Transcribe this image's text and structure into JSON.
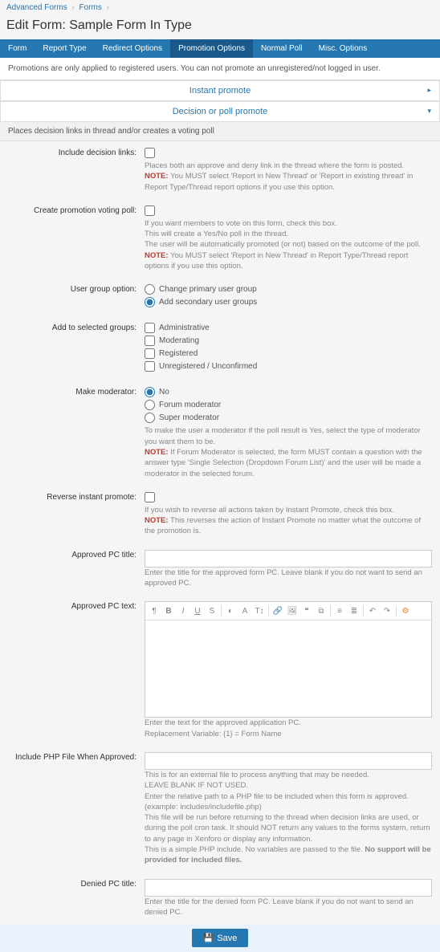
{
  "breadcrumb": {
    "a": "Advanced Forms",
    "b": "Forms"
  },
  "page_title": "Edit Form: Sample Form In Type",
  "tabs": [
    "Form",
    "Report Type",
    "Redirect Options",
    "Promotion Options",
    "Normal Poll",
    "Misc. Options"
  ],
  "info_bar": "Promotions are only applied to registered users. You can not promote an unregistered/not logged in user.",
  "acc1": "Instant promote",
  "acc2": "Decision or poll promote",
  "section": "Places decision links in thread and/or creates a voting poll",
  "f_decision": {
    "label": "Include decision links:",
    "help1": "Places both an approve and deny link in the thread where the form is posted.",
    "note": "NOTE:",
    "help2": " You MUST select 'Report in New Thread' or 'Report in existing thread' in Report Type/Thread report options if you use this option."
  },
  "f_poll": {
    "label": "Create promotion voting poll:",
    "help1": "If you want members to vote on this form, check this box.",
    "help2": "This will create a Yes/No poll in the thread.",
    "help3": "The user will be automatically promoted (or not) based on the outcome of the poll.",
    "note": "NOTE:",
    "help4": " You MUST select 'Report in New Thread' in Report Type/Thread report options if you use this option."
  },
  "f_group": {
    "label": "User group option:",
    "opt1": "Change primary user group",
    "opt2": "Add secondary user groups"
  },
  "f_add": {
    "label": "Add to selected groups:",
    "opts": [
      "Administrative",
      "Moderating",
      "Registered",
      "Unregistered / Unconfirmed"
    ]
  },
  "f_mod": {
    "label": "Make moderator:",
    "opts": [
      "No",
      "Forum moderator",
      "Super moderator"
    ],
    "help1": "To make the user a moderator if the poll result is Yes, select the type of moderator you want them to be.",
    "note": "NOTE:",
    "help2": " If Forum Moderator is selected, the form MUST contain a question with the answer type 'Single Selection (Dropdown Forum List)' and the user will be made a moderator in the selected forum."
  },
  "f_rev": {
    "label": "Reverse instant promote:",
    "help1": "If you wish to reverse all actions taken by Instant Promote, check this box.",
    "note": "NOTE:",
    "help2": " This reverses the action of Instant Promote no matter what the outcome of the promotion is."
  },
  "f_aptitle": {
    "label": "Approved PC title:",
    "help": "Enter the title for the approved form PC. Leave blank if you do not want to send an approved PC."
  },
  "f_aptext": {
    "label": "Approved PC text:",
    "help1": "Enter the text for the approved application PC.",
    "help2": "Replacement Variable: {1} = Form Name"
  },
  "f_php": {
    "label": "Include PHP File When Approved:",
    "help1": "This is for an external file to process anything that may be needed.",
    "help2": "LEAVE BLANK IF NOT USED.",
    "help3": "Enter the relative path to a PHP file to be included when this form is approved. (example: includes/includefile.php)",
    "help4": "This file will be run before returning to the thread when decision links are used, or during the poll cron task. It should NOT return any values to the forms system, return to any page in Xenforo or display any information.",
    "help5": "This is a simple PHP include. No variables are passed to the file. ",
    "help5b": "No support will be provided for included files."
  },
  "f_dntitle": {
    "label": "Denied PC title:",
    "help": "Enter the title for the denied form PC. Leave blank if you do not want to send an denied PC."
  },
  "save": "Save",
  "caret_right": "▸",
  "caret_down": "▾"
}
